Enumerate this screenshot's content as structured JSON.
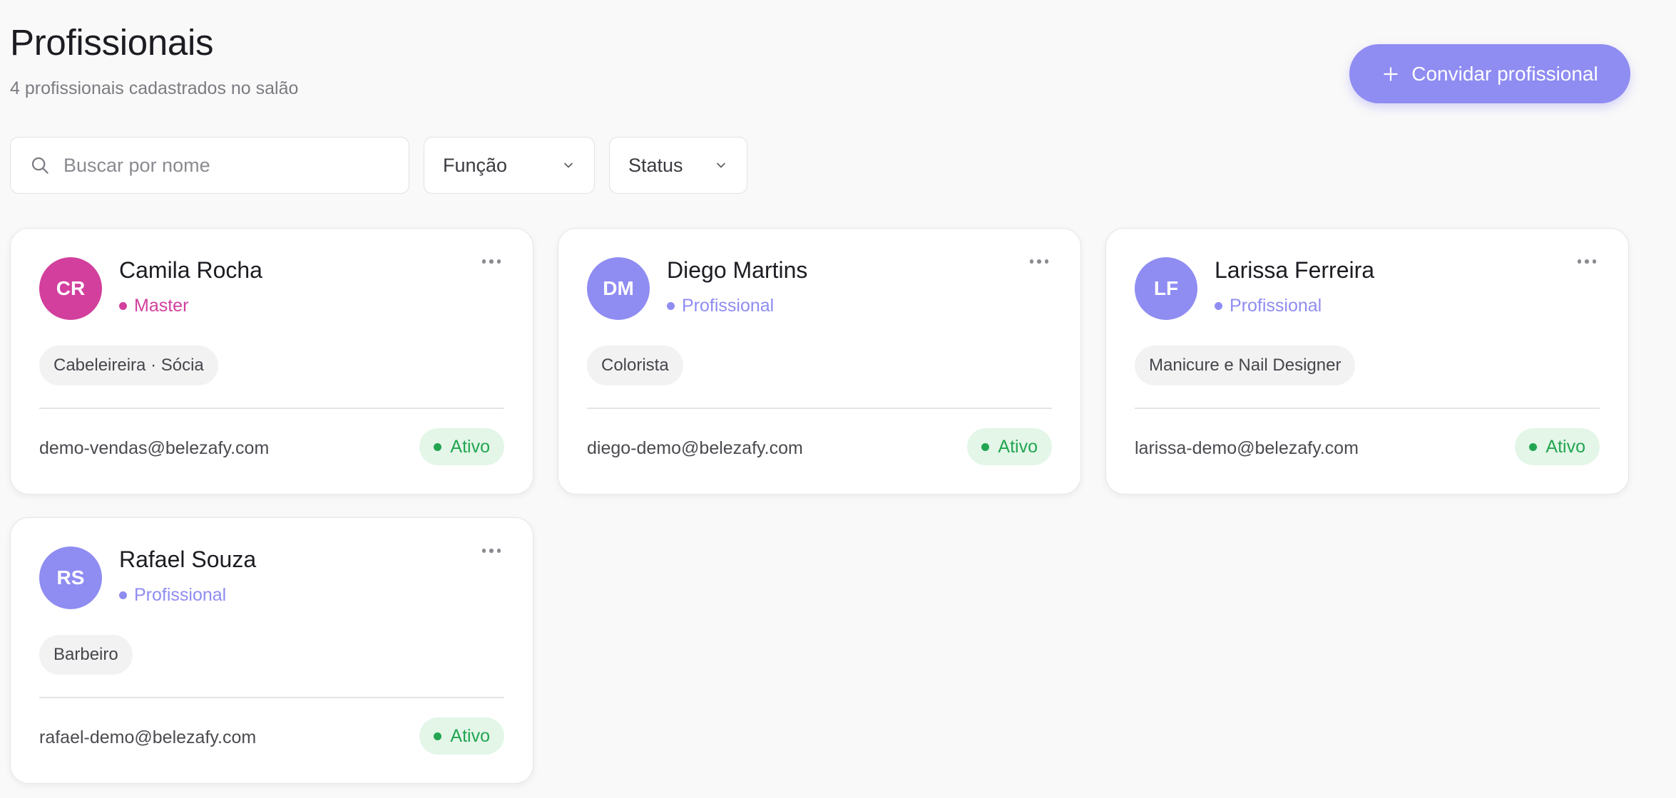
{
  "header": {
    "title": "Profissionais",
    "subtitle": "4 profissionais cadastrados no salão",
    "invite_label": "Convidar profissional"
  },
  "filters": {
    "search_placeholder": "Buscar por nome",
    "role_label": "Função",
    "status_label": "Status"
  },
  "colors": {
    "accent": "#8f8cf2",
    "master": "#d23f9d",
    "active_text": "#23a551",
    "active_bg": "#e3f6e8"
  },
  "professionals": [
    {
      "initials": "CR",
      "name": "Camila Rocha",
      "role": "Master",
      "role_color": "#d23f9d",
      "avatar_color": "#d23f9d",
      "specialty": "Cabeleireira · Sócia",
      "email": "demo-vendas@belezafy.com",
      "status": "Ativo"
    },
    {
      "initials": "DM",
      "name": "Diego Martins",
      "role": "Profissional",
      "role_color": "#8f8cf2",
      "avatar_color": "#8f8cf2",
      "specialty": "Colorista",
      "email": "diego-demo@belezafy.com",
      "status": "Ativo"
    },
    {
      "initials": "LF",
      "name": "Larissa Ferreira",
      "role": "Profissional",
      "role_color": "#8f8cf2",
      "avatar_color": "#8f8cf2",
      "specialty": "Manicure e Nail Designer",
      "email": "larissa-demo@belezafy.com",
      "status": "Ativo"
    },
    {
      "initials": "RS",
      "name": "Rafael Souza",
      "role": "Profissional",
      "role_color": "#8f8cf2",
      "avatar_color": "#8f8cf2",
      "specialty": "Barbeiro",
      "email": "rafael-demo@belezafy.com",
      "status": "Ativo"
    }
  ]
}
